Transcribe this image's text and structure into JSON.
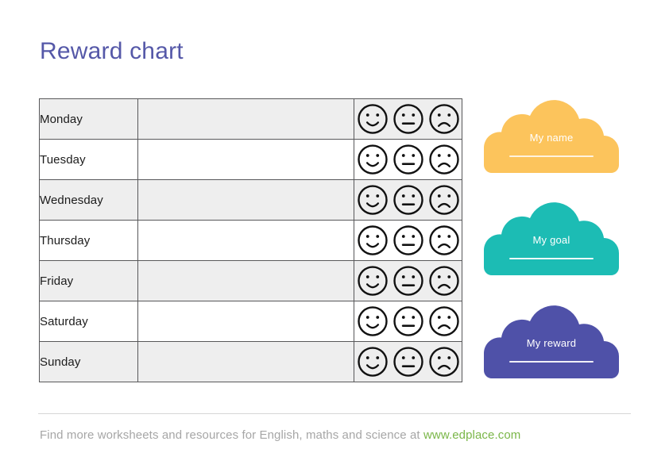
{
  "page": {
    "title": "Reward chart"
  },
  "table": {
    "rows": [
      {
        "day": "Monday",
        "notes": "",
        "shaded": true
      },
      {
        "day": "Tuesday",
        "notes": "",
        "shaded": false
      },
      {
        "day": "Wednesday",
        "notes": "",
        "shaded": true
      },
      {
        "day": "Thursday",
        "notes": "",
        "shaded": false
      },
      {
        "day": "Friday",
        "notes": "",
        "shaded": true
      },
      {
        "day": "Saturday",
        "notes": "",
        "shaded": false
      },
      {
        "day": "Sunday",
        "notes": "",
        "shaded": true
      }
    ],
    "face_options": [
      "happy-face",
      "neutral-face",
      "sad-face"
    ]
  },
  "clouds": [
    {
      "label": "My name",
      "color": "#fcc45c"
    },
    {
      "label": "My goal",
      "color": "#1cbcb4"
    },
    {
      "label": "My reward",
      "color": "#4f51a8"
    }
  ],
  "footer": {
    "text": "Find more worksheets and resources for English, maths and science at ",
    "url": "www.edplace.com"
  },
  "colors": {
    "title": "#5558a8",
    "row_shaded": "#eeeeee",
    "row_plain": "#ffffff",
    "table_border": "#58585a",
    "footer_text": "#a6a6a6",
    "footer_url": "#7ab648"
  }
}
